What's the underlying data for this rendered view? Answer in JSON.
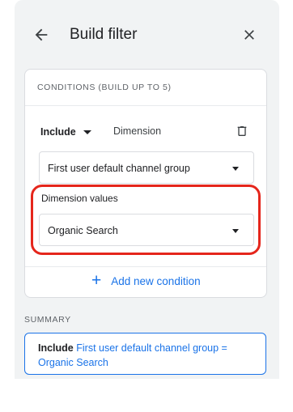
{
  "header": {
    "title": "Build filter",
    "back_icon": "arrow-left-icon",
    "close_icon": "close-icon"
  },
  "conditions": {
    "title": "CONDITIONS (BUILD UP TO 5)",
    "include_label": "Include",
    "dimension_label": "Dimension",
    "dimension_select_value": "First user default channel group",
    "dimension_values_label": "Dimension values",
    "dimension_values_select_value": "Organic Search",
    "add_condition_label": "Add new condition",
    "delete_icon": "trash-icon"
  },
  "summary": {
    "label": "SUMMARY",
    "include": "Include",
    "text": "First user default channel group = Organic Search"
  },
  "colors": {
    "accent": "#1a73e8",
    "highlight": "#e5261c",
    "panel_bg": "#f1f3f4"
  }
}
